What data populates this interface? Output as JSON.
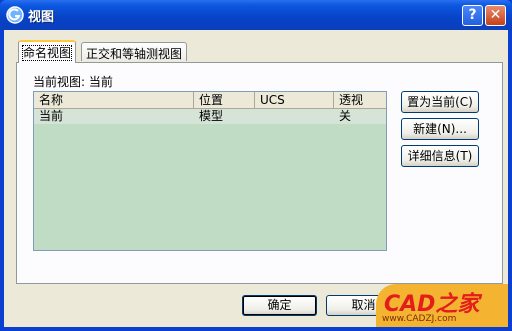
{
  "window": {
    "title": "视图"
  },
  "titlebar_buttons": {
    "help": "?",
    "close": "✕"
  },
  "tabs": [
    {
      "label": "命名视图",
      "active": true
    },
    {
      "label": "正交和等轴测视图",
      "active": false
    }
  ],
  "current_view": {
    "label": "当前视图: 当前"
  },
  "list": {
    "columns": [
      "名称",
      "位置",
      "UCS",
      "透视"
    ],
    "rows": [
      {
        "name": "当前",
        "location": "模型",
        "ucs": "",
        "perspective": "关"
      }
    ]
  },
  "side_buttons": {
    "set_current": "置为当前(C)",
    "new": "新建(N)...",
    "details": "详细信息(T)"
  },
  "bottom_buttons": {
    "ok": "确定",
    "cancel": "取消"
  },
  "watermark": {
    "text": "CAD之家",
    "sub": "www.CADZJ.com"
  },
  "colors": {
    "titlebar": "#0A3FBD",
    "list_bg": "#C1DCC4",
    "face": "#ECE9D8"
  },
  "icons": {
    "app": "app-logo-icon",
    "help": "help-icon",
    "close": "close-icon"
  }
}
